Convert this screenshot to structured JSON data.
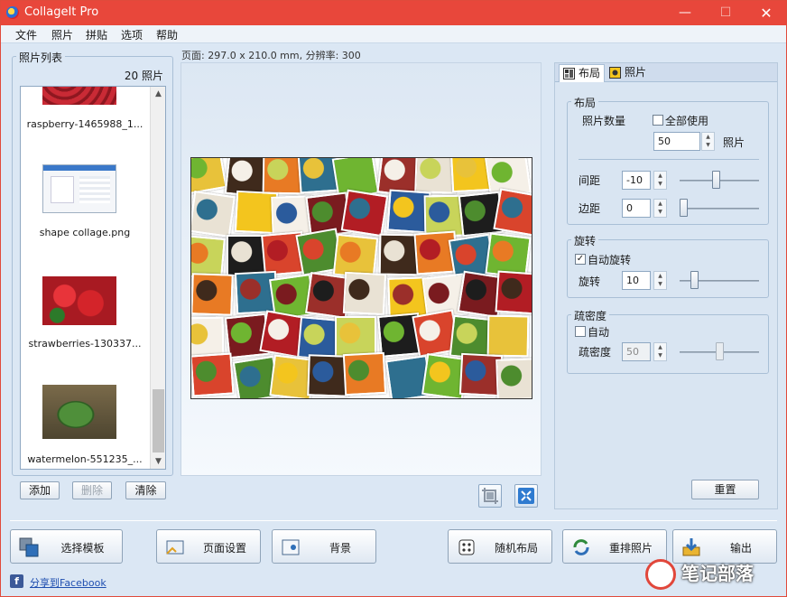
{
  "window": {
    "title": "CollageIt Pro",
    "controls": {
      "minimize": "—",
      "maximize": "☐",
      "close": "✕"
    }
  },
  "menu": [
    "文件",
    "照片",
    "拼贴",
    "选项",
    "帮助"
  ],
  "photo_list": {
    "title": "照片列表",
    "count": "20 照片",
    "items": [
      {
        "label": "raspberry-1465988_1...",
        "thumb_color": "#b3232c"
      },
      {
        "label": "shape collage.png",
        "thumb_color": "#f2f4f7"
      },
      {
        "label": "strawberries-130337...",
        "thumb_color": "#c9262a"
      },
      {
        "label": "watermelon-551235_...",
        "thumb_color": "#3f7a36"
      }
    ],
    "buttons": {
      "add": "添加",
      "delete": "删除",
      "clear": "清除"
    }
  },
  "page_info": "页面: 297.0 x 210.0 mm, 分辨率: 300",
  "collage_colors": [
    "#e8c23a",
    "#1d1d1d",
    "#b21d24",
    "#f3c51e",
    "#6fb531",
    "#3f2a1c",
    "#d9442c",
    "#2b5b9c",
    "#f5f0e8",
    "#9b2f2a",
    "#e87a24",
    "#4d8c2e",
    "#c8d45a",
    "#7a1b1f",
    "#e9e2d4",
    "#2e6f8f"
  ],
  "tabs": {
    "layout": "布局",
    "photos": "照片"
  },
  "layout_group": {
    "title": "布局",
    "photo_count_label": "照片数量",
    "use_all_label": "全部使用",
    "use_all_checked": false,
    "photo_count_value": "50",
    "photo_unit": "照片",
    "spacing_label": "间距",
    "spacing_value": "-10",
    "spacing_slider": 0.45,
    "margin_label": "边距",
    "margin_value": "0",
    "margin_slider": 0.0
  },
  "rotation_group": {
    "title": "旋转",
    "auto_rotate_label": "自动旋转",
    "auto_rotate_checked": true,
    "rotate_label": "旋转",
    "rotate_value": "10",
    "rotate_slider": 0.15
  },
  "density_group": {
    "title": "疏密度",
    "auto_label": "自动",
    "auto_checked": false,
    "density_label": "疏密度",
    "density_value": "50",
    "density_slider": 0.5
  },
  "reset_label": "重置",
  "bottom_buttons": {
    "template": "选择模板",
    "page_setup": "页面设置",
    "background": "背景",
    "random_layout": "随机布局",
    "shuffle": "重排照片",
    "export": "输出"
  },
  "facebook_share": "分享到Facebook",
  "watermark": "笔记部落"
}
